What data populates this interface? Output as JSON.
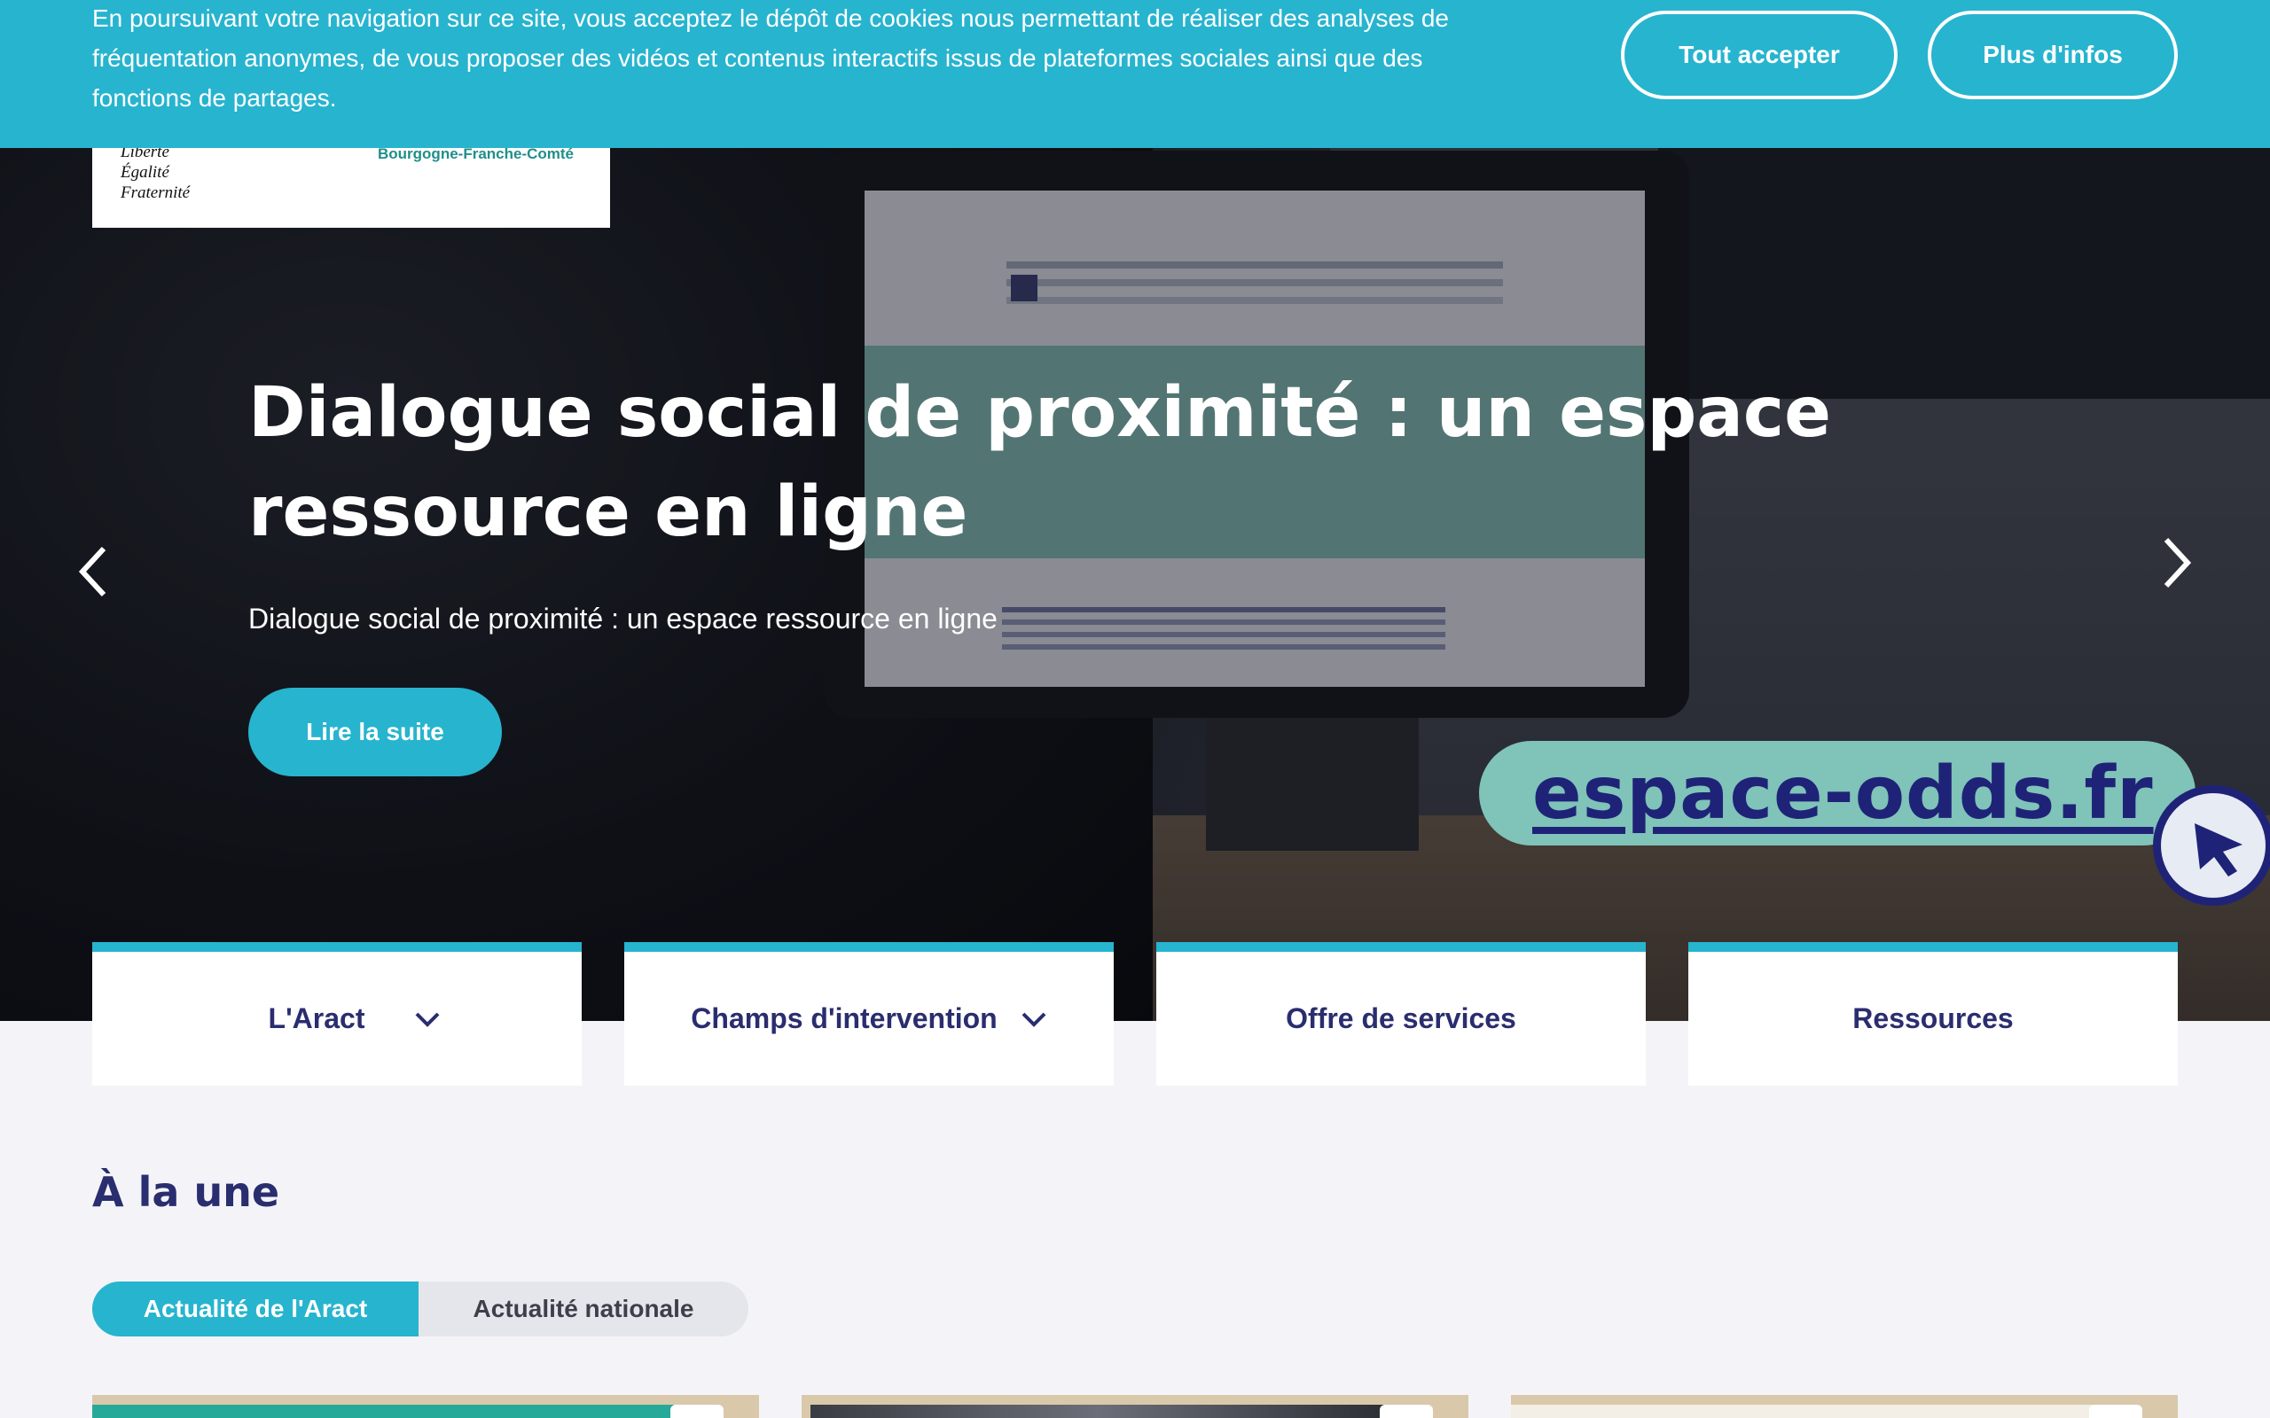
{
  "cookie_banner": {
    "text": "En poursuivant votre navigation sur ce site, vous acceptez le dépôt de cookies nous permettant de réaliser des analyses de fréquentation anonymes, de vous proposer des vidéos et contenus interactifs issus de plateformes sociales ainsi que des fonctions de partages.",
    "accept_label": "Tout accepter",
    "more_label": "Plus d'infos"
  },
  "logo": {
    "motto_1": "Liberté",
    "motto_2": "Égalité",
    "motto_3": "Fraternité",
    "region": "Bourgogne-Franche-Comté"
  },
  "hero": {
    "title": "Dialogue social de proximité : un espace ressource en ligne",
    "subtitle": "Dialogue social de proximité : un espace ressource en ligne",
    "cta_label": "Lire la suite",
    "image_text": "espace-odds.fr"
  },
  "nav": {
    "items": [
      {
        "label": "L'Aract",
        "has_dropdown": true
      },
      {
        "label": "Champs d'intervention",
        "has_dropdown": true
      },
      {
        "label": "Offre de services",
        "has_dropdown": false
      },
      {
        "label": "Ressources",
        "has_dropdown": false
      }
    ]
  },
  "news": {
    "title": "À la une",
    "tabs": [
      {
        "label": "Actualité de l'Aract",
        "active": true
      },
      {
        "label": "Actualité nationale",
        "active": false
      }
    ]
  },
  "colors": {
    "accent": "#27b4cf",
    "navy": "#2a2d6e",
    "background": "#f4f4f8"
  },
  "icons": [
    "chevron-left-icon",
    "chevron-right-icon",
    "chevron-down-icon",
    "bookmark-icon",
    "cursor-icon"
  ]
}
